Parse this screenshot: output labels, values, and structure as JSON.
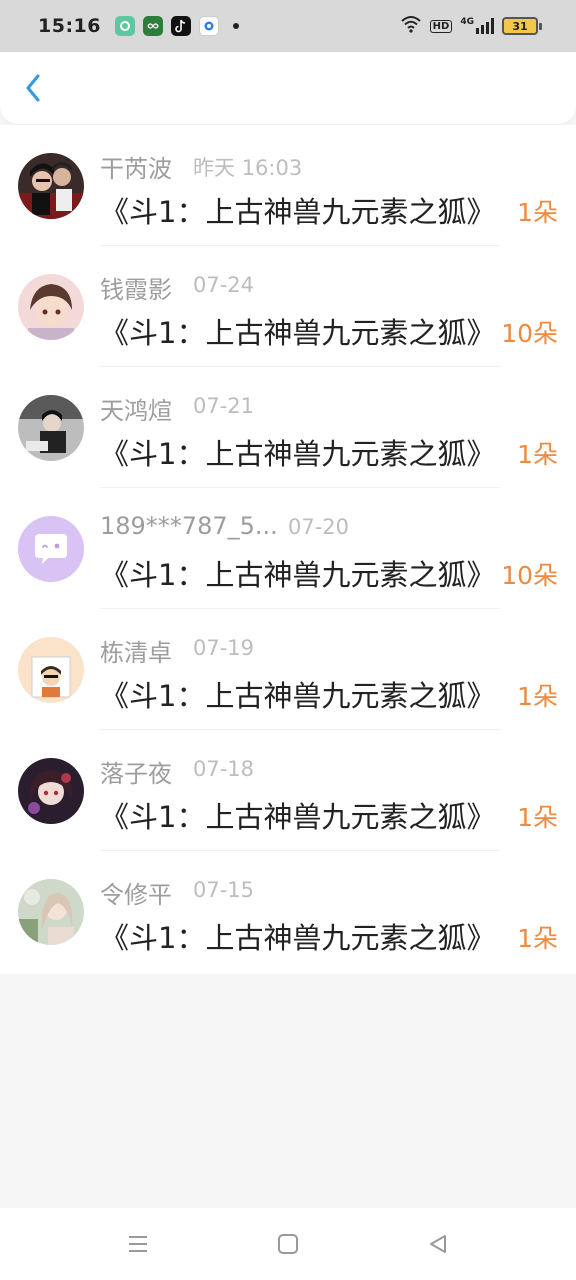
{
  "status_bar": {
    "time": "15:16",
    "hd_label": "HD",
    "network_label": "4G",
    "battery": "31",
    "apps": [
      "app-icon-green-circle",
      "app-icon-infinity",
      "app-icon-tiktok",
      "app-icon-blue-circle"
    ]
  },
  "header": {
    "back_icon": "chevron-left-icon",
    "accent_color": "#2f9ae0"
  },
  "colors": {
    "name": "#9d9d9d",
    "date": "#bdbdbd",
    "amount": "#ef8a3e",
    "book": "#222222"
  },
  "items": [
    {
      "name": "干芮波",
      "date": "昨天 16:03",
      "book": "《斗1：上古神兽九元素之狐》",
      "amount": "1朵"
    },
    {
      "name": "钱霞影",
      "date": "07-24",
      "book": "《斗1：上古神兽九元素之狐》",
      "amount": "10朵"
    },
    {
      "name": "天鸿煊",
      "date": "07-21",
      "book": "《斗1：上古神兽九元素之狐》",
      "amount": "1朵"
    },
    {
      "name": "189***787_5...",
      "date": "07-20",
      "book": "《斗1：上古神兽九元素之狐》",
      "amount": "10朵"
    },
    {
      "name": "栋清卓",
      "date": "07-19",
      "book": "《斗1：上古神兽九元素之狐》",
      "amount": "1朵"
    },
    {
      "name": "落子夜",
      "date": "07-18",
      "book": "《斗1：上古神兽九元素之狐》",
      "amount": "1朵"
    },
    {
      "name": "令修平",
      "date": "07-15",
      "book": "《斗1：上古神兽九元素之狐》",
      "amount": "1朵"
    }
  ],
  "nav": {
    "menu_icon": "menu-icon",
    "home_icon": "home-square-icon",
    "back_icon": "back-triangle-icon"
  }
}
